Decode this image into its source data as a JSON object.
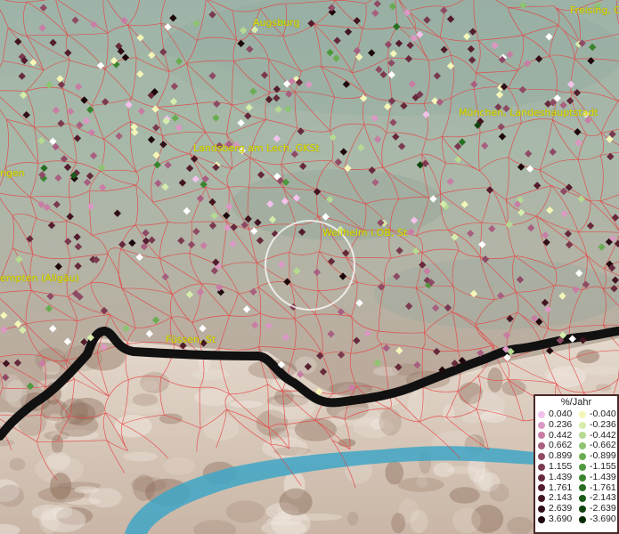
{
  "cities": [
    {
      "name": "Augsburg"
    },
    {
      "name": "Freising, G"
    },
    {
      "name": "München, Landeshauptstadt"
    },
    {
      "name": "Landsberg am Lech, GKSt"
    },
    {
      "name": "ngen"
    },
    {
      "name": "Weilheim i.OB, St"
    },
    {
      "name": "empten (Allgäu)"
    },
    {
      "name": "Füssen, St"
    }
  ],
  "legend": {
    "title": "%/Jahr",
    "positive": [
      {
        "label": "0.040",
        "color": "#f2c2ea"
      },
      {
        "label": "0.236",
        "color": "#dc98c4"
      },
      {
        "label": "0.442",
        "color": "#c87ea4"
      },
      {
        "label": "0.662",
        "color": "#a85f80"
      },
      {
        "label": "0.899",
        "color": "#8f4a64"
      },
      {
        "label": "1.155",
        "color": "#7a3a4f"
      },
      {
        "label": "1.439",
        "color": "#662a3c"
      },
      {
        "label": "1.761",
        "color": "#541e2e"
      },
      {
        "label": "2.143",
        "color": "#431622"
      },
      {
        "label": "2.639",
        "color": "#320f18"
      },
      {
        "label": "3.690",
        "color": "#1e080c"
      }
    ],
    "negative": [
      {
        "label": "-0.040",
        "color": "#f4f6b8"
      },
      {
        "label": "-0.236",
        "color": "#d6ecac"
      },
      {
        "label": "-0.442",
        "color": "#b6da92"
      },
      {
        "label": "-0.662",
        "color": "#8cc470"
      },
      {
        "label": "-0.899",
        "color": "#6aac52"
      },
      {
        "label": "-1.155",
        "color": "#4e983e"
      },
      {
        "label": "-1.439",
        "color": "#3a842f"
      },
      {
        "label": "-1.761",
        "color": "#286e22"
      },
      {
        "label": "-2.143",
        "color": "#1b5a18"
      },
      {
        "label": "-2.639",
        "color": "#10440f"
      },
      {
        "label": "-3.690",
        "color": "#062c06"
      }
    ]
  },
  "colors": {
    "city_label": "#e7e600",
    "boundary": "#e84040",
    "border": "#111111",
    "lake": "#3fa6c6"
  }
}
